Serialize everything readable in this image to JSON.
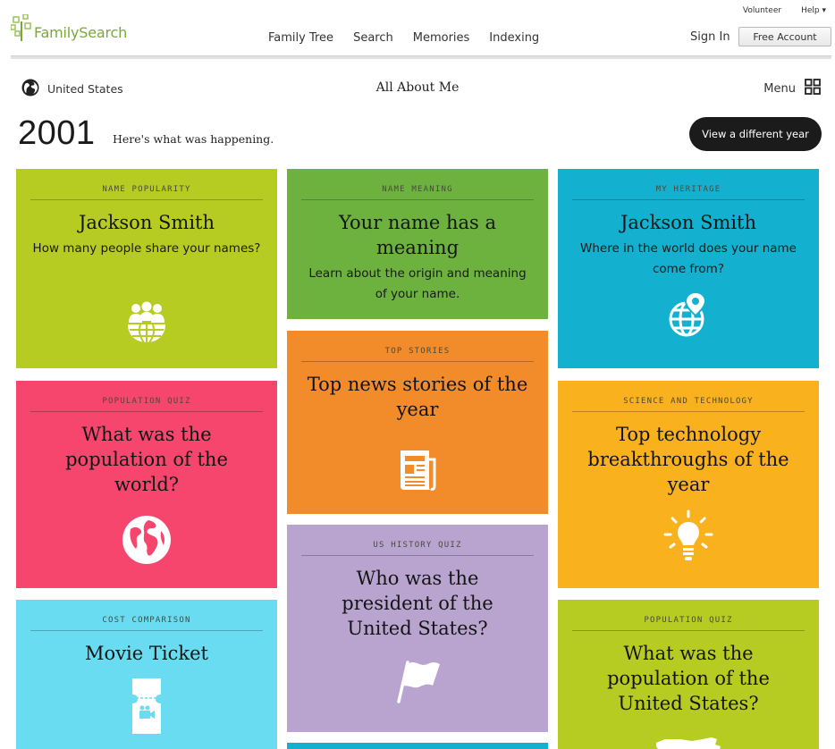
{
  "header": {
    "logo_text": "FamilySearch",
    "util_links": [
      "Volunteer",
      "Help ▾"
    ],
    "nav": [
      "Family Tree",
      "Search",
      "Memories",
      "Indexing"
    ],
    "sign_in": "Sign In",
    "free_account": "Free Account"
  },
  "subheader": {
    "country": "United States",
    "title": "All About Me",
    "menu_label": "Menu",
    "year": "2001",
    "happening": "Here's what was happening.",
    "view_year_button": "View a different year"
  },
  "tiles": [
    {
      "category": "NAME POPULARITY",
      "heading": "Jackson Smith",
      "sub": "How many people share your names?",
      "icon": "people-globe-icon",
      "color": "#b7cc22"
    },
    {
      "category": "NAME MEANING",
      "heading": "Your name has a meaning",
      "sub": "Learn about the origin and meaning of your name.",
      "icon": "",
      "color": "#6db23f"
    },
    {
      "category": "MY HERITAGE",
      "heading": "Jackson Smith",
      "sub": "Where in the world does your name come from?",
      "icon": "globe-pin-icon",
      "color": "#13b1cf"
    },
    {
      "category": "TOP STORIES",
      "heading": "Top news stories of the year",
      "sub": "",
      "icon": "newspaper-icon",
      "color": "#f28c2a"
    },
    {
      "category": "POPULATION QUIZ",
      "heading": "What was the population of the world?",
      "sub": "",
      "icon": "earth-icon",
      "color": "#f6466e"
    },
    {
      "category": "SCIENCE AND TECHNOLOGY",
      "heading": "Top technology breakthroughs of the year",
      "sub": "",
      "icon": "lightbulb-icon",
      "color": "#f9b21d"
    },
    {
      "category": "US HISTORY QUIZ",
      "heading": "Who was the president of the United States?",
      "sub": "",
      "icon": "flag-icon",
      "color": "#b9a4d0"
    },
    {
      "category": "COST COMPARISON",
      "heading": "Movie Ticket",
      "sub": "",
      "icon": "ticket-icon",
      "color": "#6adcf2"
    },
    {
      "category": "POPULATION QUIZ",
      "heading": "What was the population of the United States?",
      "sub": "",
      "icon": "usa-map-icon",
      "color": "#b7cc22"
    }
  ]
}
